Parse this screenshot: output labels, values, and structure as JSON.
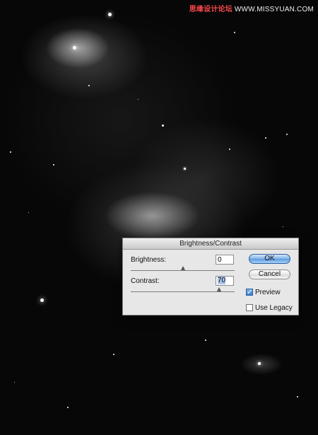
{
  "watermark": {
    "part1": "思缘设计论坛",
    "part2": "WWW.MISSYUAN.COM"
  },
  "dialog": {
    "title": "Brightness/Contrast",
    "brightness": {
      "label": "Brightness:",
      "value": "0"
    },
    "contrast": {
      "label": "Contrast:",
      "value": "70"
    },
    "ok_label": "OK",
    "cancel_label": "Cancel",
    "preview": {
      "label": "Preview",
      "checked": true
    },
    "legacy": {
      "label": "Use Legacy",
      "checked": false
    }
  },
  "colors": {
    "ok_accent": "#5c9ae0",
    "selection": "#a9c7ec"
  },
  "icons": {
    "preview_check": "checkmark-icon"
  }
}
